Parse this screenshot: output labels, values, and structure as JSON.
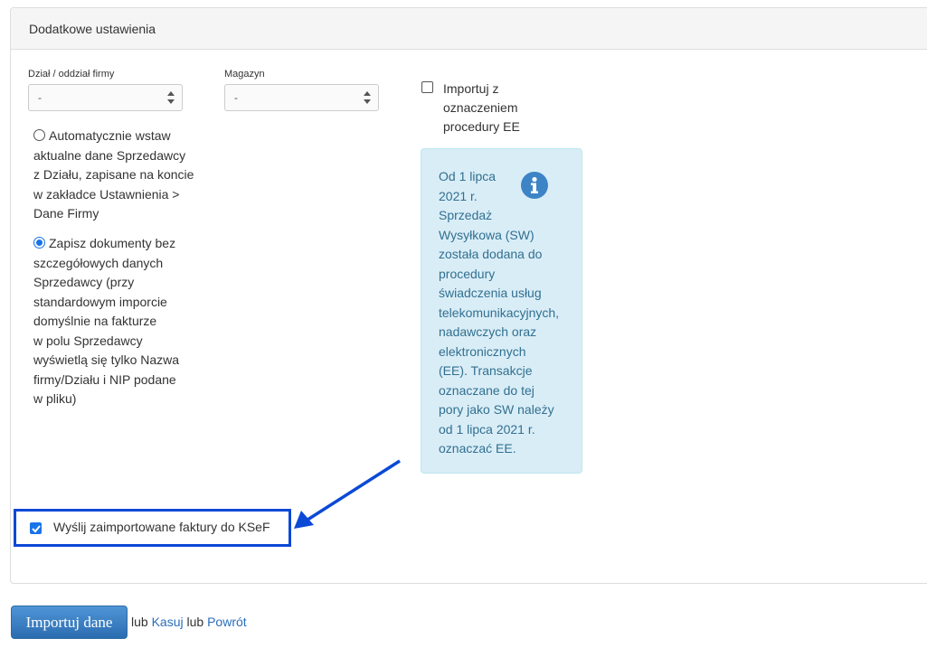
{
  "panel": {
    "title": "Dodatkowe ustawienia"
  },
  "fields": {
    "dzial": {
      "label": "Dział / oddział firmy",
      "value": "-"
    },
    "magazyn": {
      "label": "Magazyn",
      "value": "-"
    }
  },
  "radios": {
    "auto": {
      "checked": false,
      "lines": [
        "Automatycznie wstaw",
        "aktualne dane Sprzedawcy",
        "z Działu, zapisane na koncie",
        "w zakładce Ustawnienia >",
        "Dane Firmy"
      ]
    },
    "no_details": {
      "checked": true,
      "lines": [
        "Zapisz dokumenty bez",
        "szczegółowych danych",
        "Sprzedawcy (przy",
        "standardowym imporcie",
        "domyślnie na fakturze",
        "w polu Sprzedawcy",
        "wyświetlą się tylko Nazwa",
        "firmy/Działu i NIP podane",
        "w pliku)"
      ]
    }
  },
  "ee_checkbox": {
    "checked": false,
    "lines": [
      "Importuj z",
      "oznaczeniem",
      "procedury EE"
    ]
  },
  "info": {
    "icon": "info-circle-icon",
    "lines": [
      "Od 1 lipca",
      "2021 r.",
      "Sprzedaż",
      "Wysyłkowa (SW)",
      "została dodana do",
      "procedury",
      "świadczenia usług",
      "telekomunikacyjnych,",
      "nadawczych oraz",
      "elektronicznych",
      "(EE). Transakcje",
      "oznaczane do tej",
      "pory jako SW należy",
      "od 1 lipca 2021 r.",
      "oznaczać EE."
    ]
  },
  "ksef": {
    "checked": true,
    "label": "Wyślij zaimportowane faktury do KSeF"
  },
  "actions": {
    "import_label": "Importuj dane",
    "sep1": "lub",
    "cancel_label": "Kasuj",
    "sep2": "lub",
    "back_label": "Powrót"
  },
  "colors": {
    "accent": "#1a73e8",
    "highlight_border": "#0b49d6",
    "info_bg": "#d9edf7",
    "info_text": "#31708f",
    "button_bg": "#337ab7",
    "link": "#2a6ebb"
  }
}
